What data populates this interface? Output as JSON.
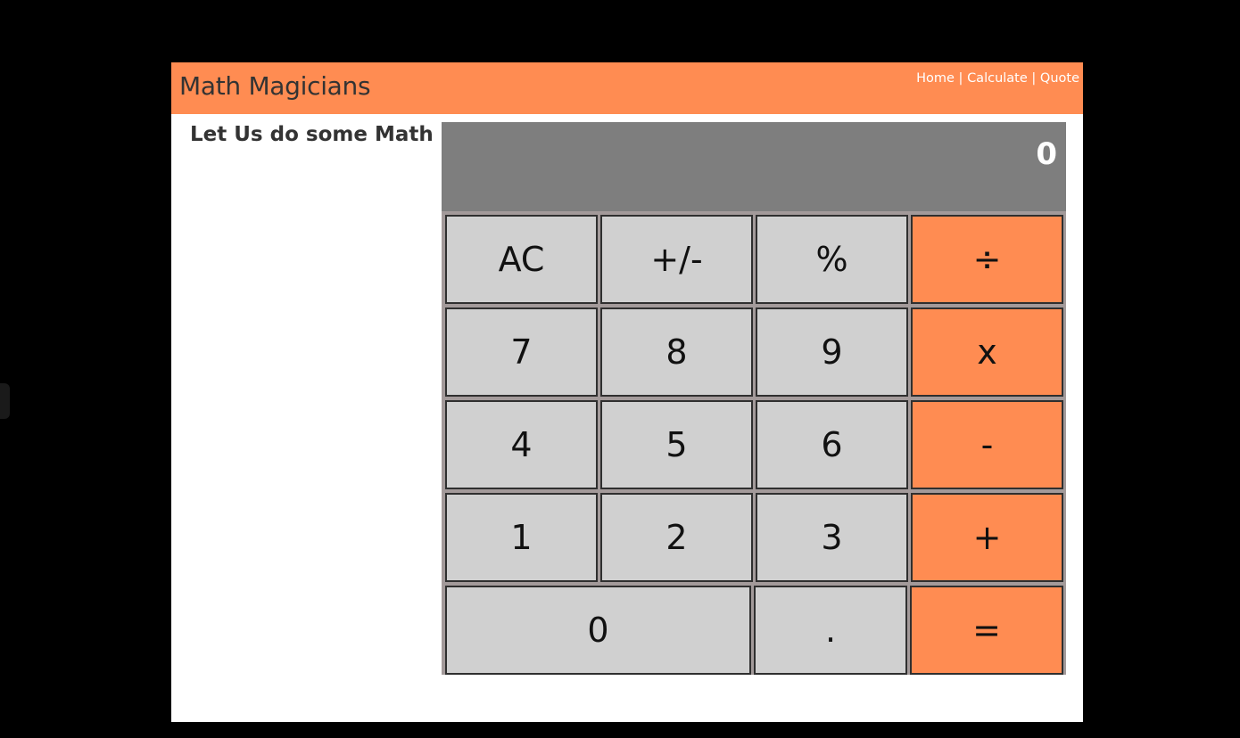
{
  "nav": {
    "brand": "Math Magicians",
    "links": [
      {
        "label": "Home"
      },
      {
        "label": "Calculate"
      },
      {
        "label": "Quote"
      }
    ],
    "separator": " | "
  },
  "page": {
    "intro_text": "Let Us do some Math"
  },
  "calculator": {
    "display_value": "0",
    "buttons": {
      "ac": "AC",
      "sign": "+/-",
      "percent": "%",
      "divide": "÷",
      "seven": "7",
      "eight": "8",
      "nine": "9",
      "multiply": "x",
      "four": "4",
      "five": "5",
      "six": "6",
      "minus": "-",
      "one": "1",
      "two": "2",
      "three": "3",
      "plus": "+",
      "zero": "0",
      "dot": ".",
      "equals": "="
    }
  },
  "colors": {
    "accent": "#ff8c52",
    "display_bg": "#7e7e7e",
    "key_bg": "#d0d0d0",
    "page_bg": "#000000"
  }
}
